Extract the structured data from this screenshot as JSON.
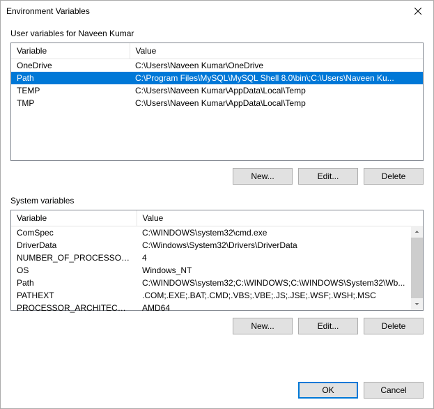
{
  "window": {
    "title": "Environment Variables"
  },
  "user_section": {
    "label": "User variables for Naveen Kumar",
    "columns": {
      "variable": "Variable",
      "value": "Value"
    },
    "rows": [
      {
        "variable": "OneDrive",
        "value": "C:\\Users\\Naveen Kumar\\OneDrive",
        "selected": false
      },
      {
        "variable": "Path",
        "value": "C:\\Program Files\\MySQL\\MySQL Shell 8.0\\bin\\;C:\\Users\\Naveen Ku...",
        "selected": true
      },
      {
        "variable": "TEMP",
        "value": "C:\\Users\\Naveen Kumar\\AppData\\Local\\Temp",
        "selected": false
      },
      {
        "variable": "TMP",
        "value": "C:\\Users\\Naveen Kumar\\AppData\\Local\\Temp",
        "selected": false
      }
    ],
    "buttons": {
      "new": "New...",
      "edit": "Edit...",
      "delete": "Delete"
    }
  },
  "system_section": {
    "label": "System variables",
    "columns": {
      "variable": "Variable",
      "value": "Value"
    },
    "rows": [
      {
        "variable": "ComSpec",
        "value": "C:\\WINDOWS\\system32\\cmd.exe"
      },
      {
        "variable": "DriverData",
        "value": "C:\\Windows\\System32\\Drivers\\DriverData"
      },
      {
        "variable": "NUMBER_OF_PROCESSORS",
        "value": "4"
      },
      {
        "variable": "OS",
        "value": "Windows_NT"
      },
      {
        "variable": "Path",
        "value": "C:\\WINDOWS\\system32;C:\\WINDOWS;C:\\WINDOWS\\System32\\Wb..."
      },
      {
        "variable": "PATHEXT",
        "value": ".COM;.EXE;.BAT;.CMD;.VBS;.VBE;.JS;.JSE;.WSF;.WSH;.MSC"
      },
      {
        "variable": "PROCESSOR_ARCHITECTURE",
        "value": "AMD64"
      }
    ],
    "buttons": {
      "new": "New...",
      "edit": "Edit...",
      "delete": "Delete"
    }
  },
  "footer": {
    "ok": "OK",
    "cancel": "Cancel"
  }
}
